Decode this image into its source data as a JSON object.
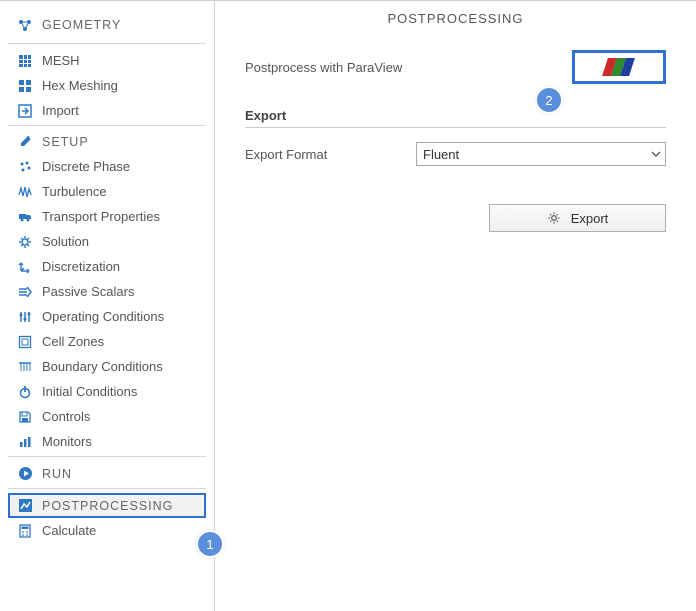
{
  "sidebar": {
    "geometry": {
      "label": "GEOMETRY"
    },
    "mesh": {
      "label": "MESH"
    },
    "hexmesh": {
      "label": "Hex Meshing"
    },
    "import": {
      "label": "Import"
    },
    "setup": {
      "label": "SETUP"
    },
    "discrete": {
      "label": "Discrete Phase"
    },
    "turb": {
      "label": "Turbulence"
    },
    "transport": {
      "label": "Transport Properties"
    },
    "solution": {
      "label": "Solution"
    },
    "discret": {
      "label": "Discretization"
    },
    "passive": {
      "label": "Passive Scalars"
    },
    "opcond": {
      "label": "Operating Conditions"
    },
    "cellzones": {
      "label": "Cell Zones"
    },
    "boundary": {
      "label": "Boundary Conditions"
    },
    "initial": {
      "label": "Initial Conditions"
    },
    "controls": {
      "label": "Controls"
    },
    "monitors": {
      "label": "Monitors"
    },
    "run": {
      "label": "RUN"
    },
    "postproc": {
      "label": "POSTPROCESSING"
    },
    "calc": {
      "label": "Calculate"
    }
  },
  "content": {
    "title": "POSTPROCESSING",
    "paraview_label": "Postprocess with ParaView",
    "export_heading": "Export",
    "export_format_label": "Export Format",
    "export_format_value": "Fluent",
    "export_button": "Export"
  },
  "annotations": {
    "badge1": "1",
    "badge2": "2"
  }
}
